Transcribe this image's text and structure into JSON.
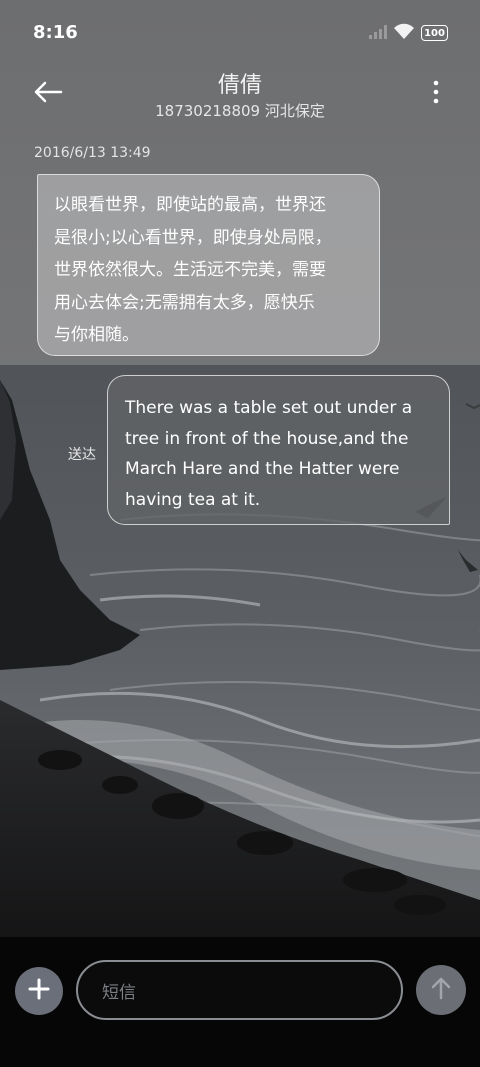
{
  "status_bar": {
    "time": "8:16",
    "battery": "100",
    "icons": [
      "signal-icon",
      "wifi-icon",
      "battery-icon"
    ]
  },
  "header": {
    "contact_name": "倩倩",
    "contact_phone": "18730218809 河北保定",
    "icons": [
      "back-arrow-icon",
      "more-vertical-icon"
    ]
  },
  "conversation": {
    "timestamp": "2016/6/13 13:49",
    "messages": [
      {
        "direction": "incoming",
        "lines": [
          "以眼看世界，即使站的最高，世界还",
          "是很小;以心看世界，即使身处局限，",
          "世界依然很大。生活远不完美，需要",
          "用心去体会;无需拥有太多，愿快乐",
          "与你相随。"
        ]
      },
      {
        "direction": "outgoing",
        "status": "送达",
        "lines": [
          "There was a table set out under a",
          "tree in front of the house,and the",
          "March Hare and the Hatter were",
          "having tea at it."
        ]
      }
    ]
  },
  "compose": {
    "placeholder": "短信",
    "icons": [
      "plus-icon",
      "send-arrow-icon"
    ]
  },
  "colors": {
    "bottom_bar": "#060606",
    "button_fill": "#6a6f79",
    "bubble_incoming": "#b0b0b2",
    "bubble_outgoing": "#626467"
  }
}
